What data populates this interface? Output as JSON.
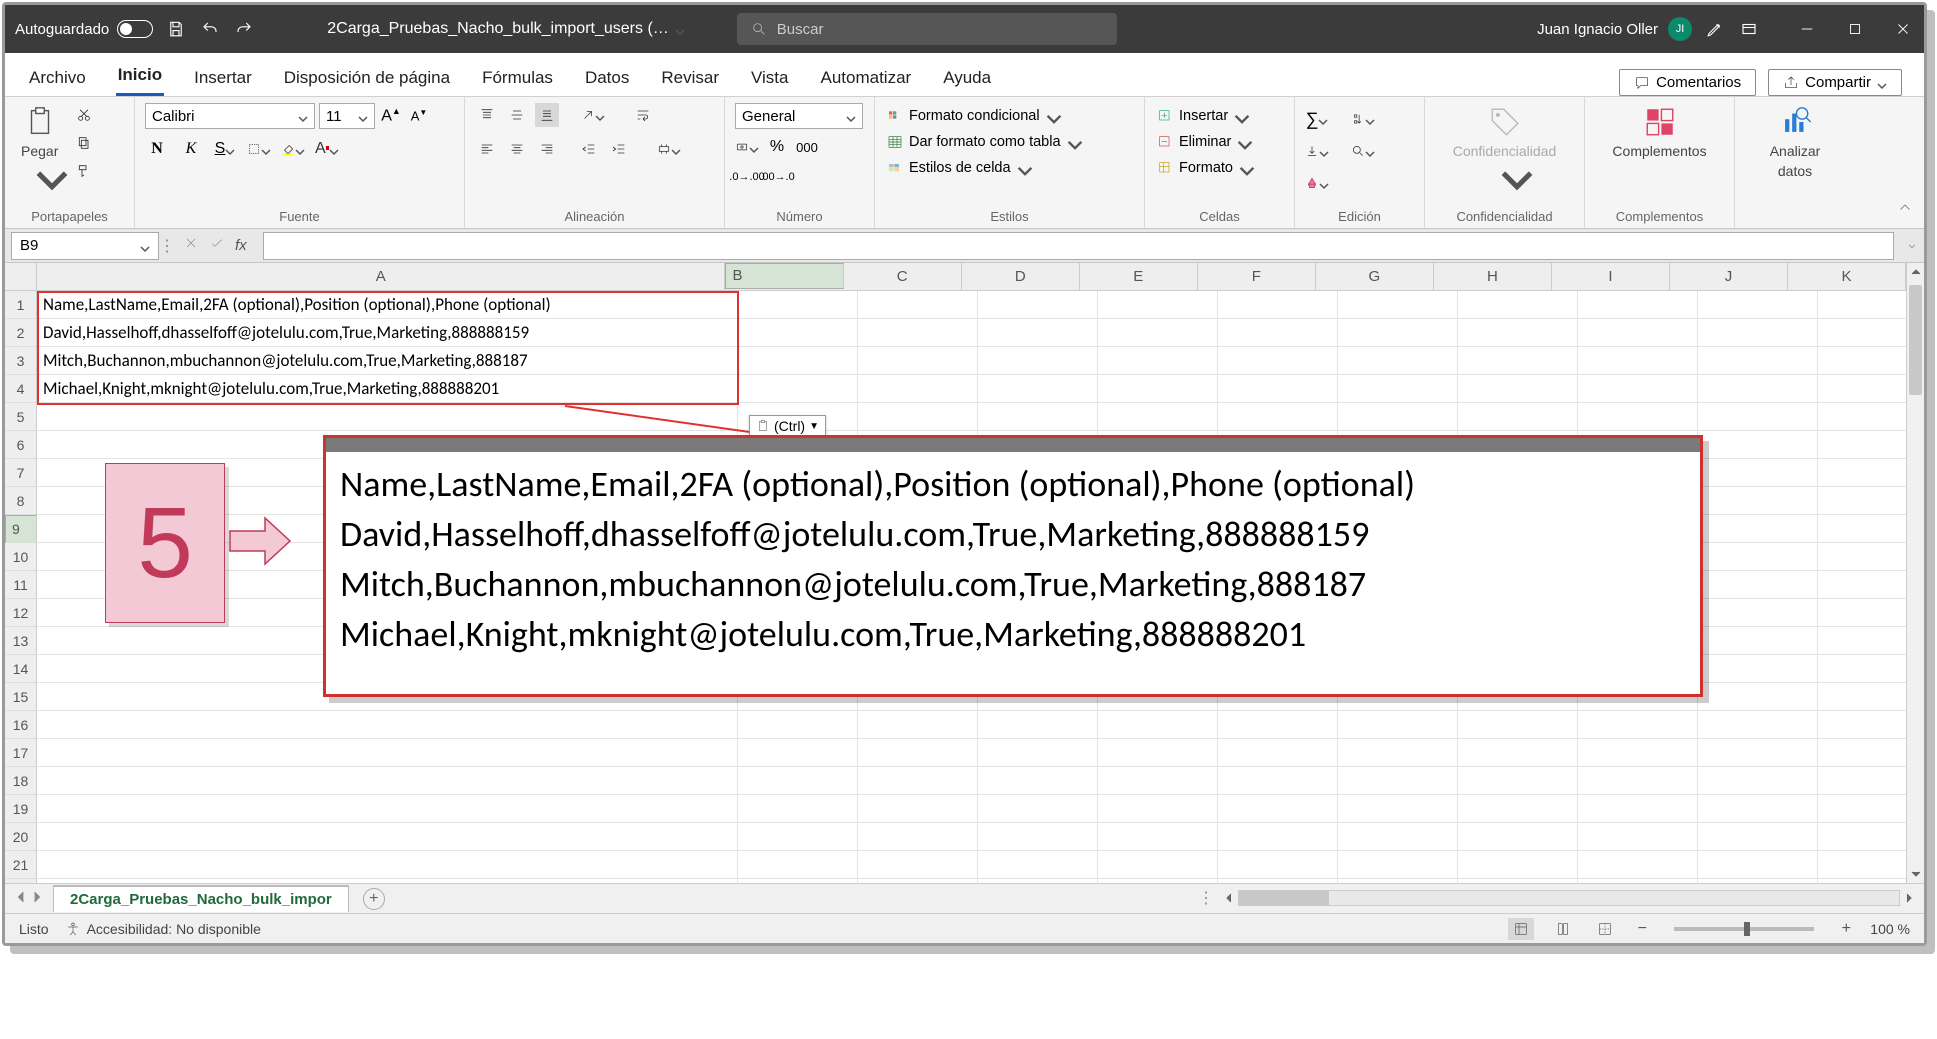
{
  "titlebar": {
    "autosave_label": "Autoguardado",
    "filename": "2Carga_Pruebas_Nacho_bulk_import_users (…",
    "search_placeholder": "Buscar",
    "user_name": "Juan Ignacio Oller",
    "user_initials": "JI"
  },
  "tabs": {
    "items": [
      "Archivo",
      "Inicio",
      "Insertar",
      "Disposición de página",
      "Fórmulas",
      "Datos",
      "Revisar",
      "Vista",
      "Automatizar",
      "Ayuda"
    ],
    "active_index": 1,
    "comments_label": "Comentarios",
    "share_label": "Compartir"
  },
  "ribbon": {
    "clipboard": {
      "paste_label": "Pegar",
      "group_label": "Portapapeles"
    },
    "font": {
      "group_label": "Fuente",
      "name": "Calibri",
      "size": "11",
      "bold": "N",
      "italic": "K",
      "underline": "S"
    },
    "alignment": {
      "group_label": "Alineación"
    },
    "number": {
      "group_label": "Número",
      "format": "General",
      "thousands": "000"
    },
    "styles": {
      "group_label": "Estilos",
      "conditional": "Formato condicional",
      "as_table": "Dar formato como tabla",
      "cell_styles": "Estilos de celda"
    },
    "cells": {
      "group_label": "Celdas",
      "insert": "Insertar",
      "delete": "Eliminar",
      "format": "Formato"
    },
    "editing": {
      "group_label": "Edición"
    },
    "confidentiality": {
      "group_label": "Confidencialidad",
      "label": "Confidencialidad"
    },
    "addins": {
      "group_label": "Complementos",
      "label": "Complementos"
    },
    "analyze": {
      "group_label": "",
      "label": "Analizar datos",
      "label1": "Analizar",
      "label2": "datos"
    }
  },
  "formula_bar": {
    "cell_ref": "B9",
    "fx": "fx"
  },
  "columns": [
    "A",
    "B",
    "C",
    "D",
    "E",
    "F",
    "G",
    "H",
    "I",
    "J",
    "K"
  ],
  "col_a_width": 700,
  "other_col_width": 120,
  "active_col_index": 1,
  "row_count": 22,
  "active_row": 9,
  "cells": {
    "A1": "Name,LastName,Email,2FA (optional),Position (optional),Phone (optional)",
    "A2": "David,Hasselhoff,dhasselfoff@jotelulu.com,True,Marketing,888888159",
    "A3": "Mitch,Buchannon,mbuchannon@jotelulu.com,True,Marketing,888187",
    "A4": "Michael,Knight,mknight@jotelulu.com,True,Marketing,888888201"
  },
  "paste_options": {
    "label": "(Ctrl)"
  },
  "callout": {
    "number": "5"
  },
  "zoom_lines": [
    "Name,LastName,Email,2FA (optional),Position (optional),Phone (optional)",
    "David,Hasselhoff,dhasselfoff@jotelulu.com,True,Marketing,888888159",
    "Mitch,Buchannon,mbuchannon@jotelulu.com,True,Marketing,888187",
    "Michael,Knight,mknight@jotelulu.com,True,Marketing,888888201"
  ],
  "sheet": {
    "name": "2Carga_Pruebas_Nacho_bulk_impor"
  },
  "status": {
    "ready": "Listo",
    "accessibility": "Accesibilidad: No disponible",
    "zoom": "100 %"
  }
}
